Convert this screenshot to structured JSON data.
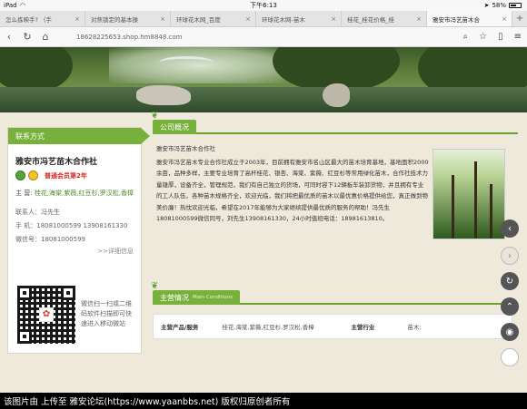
{
  "status": {
    "device": "iPad",
    "time": "下午6:13",
    "battery": "58%"
  },
  "tabs": [
    {
      "label": "怎么拣映手? （手"
    },
    {
      "label": "对焦锁定的基本操"
    },
    {
      "label": "环球花木网_百度"
    },
    {
      "label": "环球花木网-苗木"
    },
    {
      "label": "桂花_桂花价格_桂"
    },
    {
      "label": "雅安市冯艺苗木合"
    }
  ],
  "address": {
    "url": "18628225653.shop.hm8848.com"
  },
  "left": {
    "section_title": "联系方式",
    "company": "雅安市冯艺苗木合作社",
    "member": "普通会员第2年",
    "business_label": "主  营:",
    "business": "桂花,海棠,紫薇,红豆杉,罗汉松,香樟",
    "contact_label": "联系人：",
    "contact": "冯先生",
    "phone_label": "手    机：",
    "phone": "18081000599 13908161330",
    "wechat_label": "微信号：",
    "wechat": "18081000599",
    "more": ">>详细信息",
    "qr_text": "微信扫一扫或二维码软件扫描即可快速进入移动微站"
  },
  "overview": {
    "section_title": "公司概况",
    "company_name": "雅安市冯艺苗木合作社",
    "text": "雅安市冯艺苗木专业合作社成立于2003年，目前拥有雅安市名山区最大的苗木培育基地，基地面积2000余亩，品种多样，主要专业培育了高杆桂花、银杏、海棠、紫薇、红豆杉等常用绿化苗木，合作社技术力量雄厚，设备齐全，管理规范，我们有自己独立的货场，可同时容下12辆板车装卸货物，并且拥有专业的工人队伍，各种苗木规格齐全，欢迎光临，我们将把最优质的苗木以最优惠价格提供给您，真正做到物美价廉！热忱欢迎光临，希望在2017年能够为大家继续提供最优质的服务的帮助！冯先生18081000599微信同号，刘先生13908161330，24小时值班电话：18981613810。"
  },
  "main_business": {
    "section_title": "主营情况",
    "section_sub": "Main Conditions",
    "products_label": "主营产品/服务",
    "products": "桂花,海棠,紫薇,红豆杉,罗汉松,香樟",
    "industry_label": "主营行业",
    "industry": "苗木;"
  },
  "footer": {
    "text": "该图片由  上传至 雅安论坛(https://www.yaanbbs.net) 版权归原创者所有"
  }
}
